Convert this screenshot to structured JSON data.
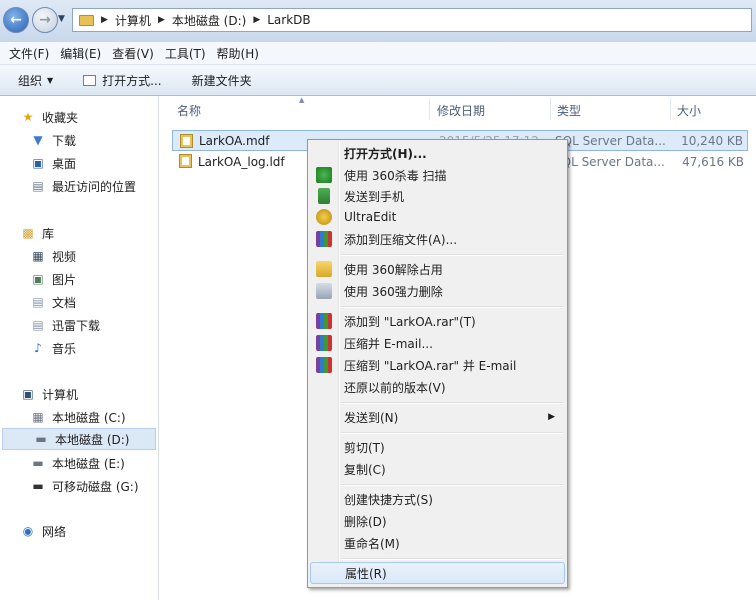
{
  "address": {
    "crumbs": [
      "计算机",
      "本地磁盘 (D:)",
      "LarkDB"
    ]
  },
  "menubar": [
    "文件(F)",
    "编辑(E)",
    "查看(V)",
    "工具(T)",
    "帮助(H)"
  ],
  "toolbar": {
    "organize": "组织",
    "open_with": "打开方式...",
    "new_folder": "新建文件夹"
  },
  "nav": {
    "favorites": "收藏夹",
    "fav_items": [
      "下载",
      "桌面",
      "最近访问的位置"
    ],
    "libraries": "库",
    "lib_items": [
      "视频",
      "图片",
      "文档",
      "迅雷下载",
      "音乐"
    ],
    "computer": "计算机",
    "drives": [
      "本地磁盘 (C:)",
      "本地磁盘 (D:)",
      "本地磁盘 (E:)",
      "可移动磁盘 (G:)"
    ],
    "network": "网络"
  },
  "columns": {
    "name": "名称",
    "modified": "修改日期",
    "type": "类型",
    "size": "大小"
  },
  "files": [
    {
      "name": "LarkOA.mdf",
      "modified": "2015/5/25 17:12",
      "type": "SQL Server Data...",
      "size": "10,240 KB"
    },
    {
      "name": "LarkOA_log.ldf",
      "modified": "",
      "type": "SQL Server Data...",
      "size": "47,616 KB"
    }
  ],
  "context_menu": {
    "open_with": "打开方式(H)...",
    "scan360": "使用 360杀毒 扫描",
    "send_phone": "发送到手机",
    "ultraedit": "UltraEdit",
    "add_archive": "添加到压缩文件(A)...",
    "unlock360": "使用 360解除占用",
    "force_delete360": "使用 360强力删除",
    "add_rar": "添加到 \"LarkOA.rar\"(T)",
    "compress_email": "压缩并 E-mail...",
    "compress_rar_email": "压缩到 \"LarkOA.rar\" 并 E-mail",
    "restore": "还原以前的版本(V)",
    "send_to": "发送到(N)",
    "cut": "剪切(T)",
    "copy": "复制(C)",
    "shortcut": "创建快捷方式(S)",
    "delete": "删除(D)",
    "rename": "重命名(M)",
    "properties": "属性(R)"
  }
}
